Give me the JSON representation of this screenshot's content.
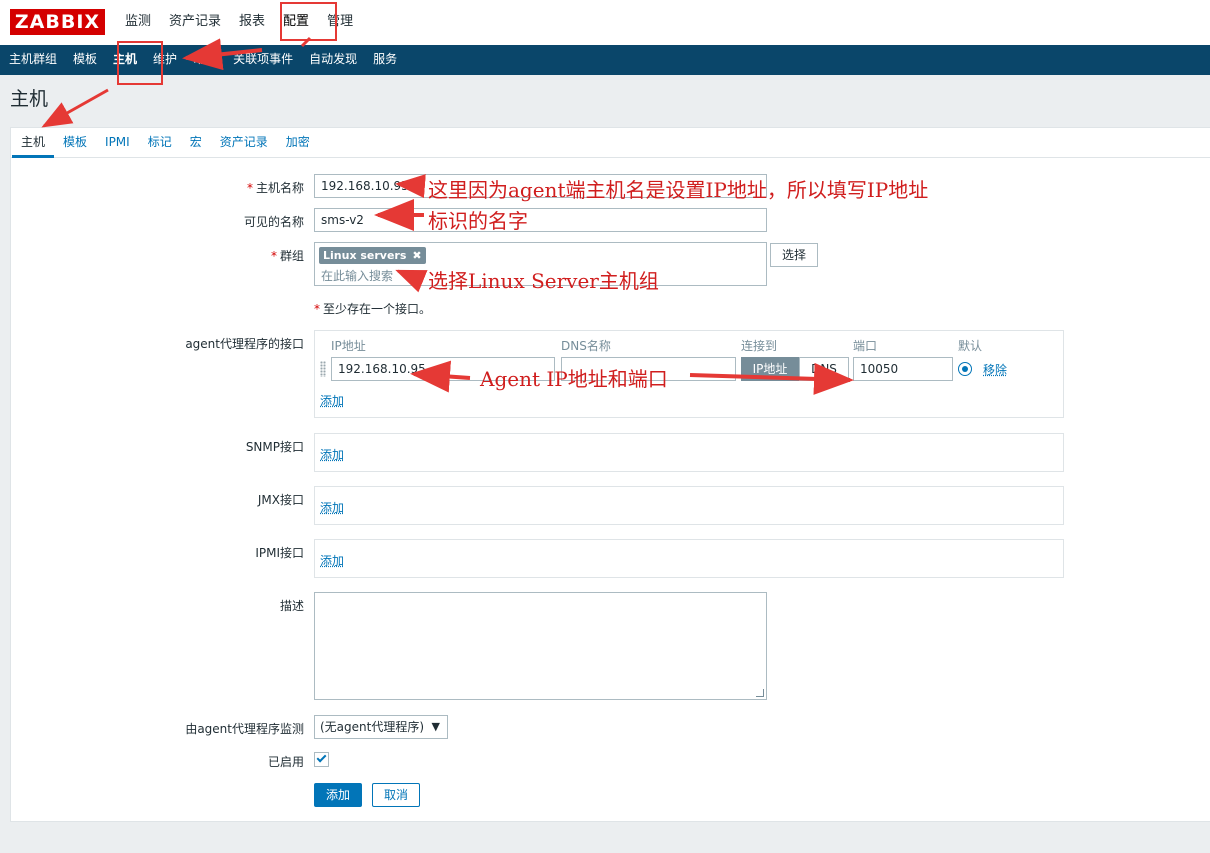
{
  "app": {
    "logo_text": "ZABBIX",
    "top_nav": [
      "监测",
      "资产记录",
      "报表",
      "配置",
      "管理"
    ],
    "sub_nav": [
      "主机群组",
      "模板",
      "主机",
      "维护",
      "动作",
      "关联项事件",
      "自动发现",
      "服务"
    ]
  },
  "page": {
    "title": "主机",
    "tabs": [
      "主机",
      "模板",
      "IPMI",
      "标记",
      "宏",
      "资产记录",
      "加密"
    ]
  },
  "form": {
    "host_name_label": "主机名称",
    "host_name_value": "192.168.10.95",
    "visible_name_label": "可见的名称",
    "visible_name_value": "sms-v2",
    "groups_label": "群组",
    "group_chip": "Linux servers",
    "group_search_placeholder": "在此输入搜索",
    "select_button": "选择",
    "interface_note": "至少存在一个接口。",
    "agent_interface_label": "agent代理程序的接口",
    "iface_headers": {
      "ip": "IP地址",
      "dns": "DNS名称",
      "connect": "连接到",
      "port": "端口",
      "default": "默认"
    },
    "agent_ip_value": "192.168.10.95",
    "agent_dns_value": "",
    "connect_ip": "IP地址",
    "connect_dns": "DNS",
    "agent_port_value": "10050",
    "remove_link": "移除",
    "add_link": "添加",
    "snmp_label": "SNMP接口",
    "jmx_label": "JMX接口",
    "ipmi_label": "IPMI接口",
    "description_label": "描述",
    "proxy_label": "由agent代理程序监测",
    "proxy_value": "(无agent代理程序)",
    "enabled_label": "已启用",
    "add_button": "添加",
    "cancel_button": "取消"
  },
  "annotations": {
    "host_name_note": "这里因为agent端主机名是设置IP地址，所以填写IP地址",
    "visible_name_note": "标识的名字",
    "group_note": "选择Linux Server主机组",
    "agent_note": "Agent IP地址和端口"
  },
  "colors": {
    "brand_red": "#d40000",
    "subnav_bg": "#0a466a",
    "link_blue": "#0275b8",
    "annotation_red": "#d01e1e"
  }
}
